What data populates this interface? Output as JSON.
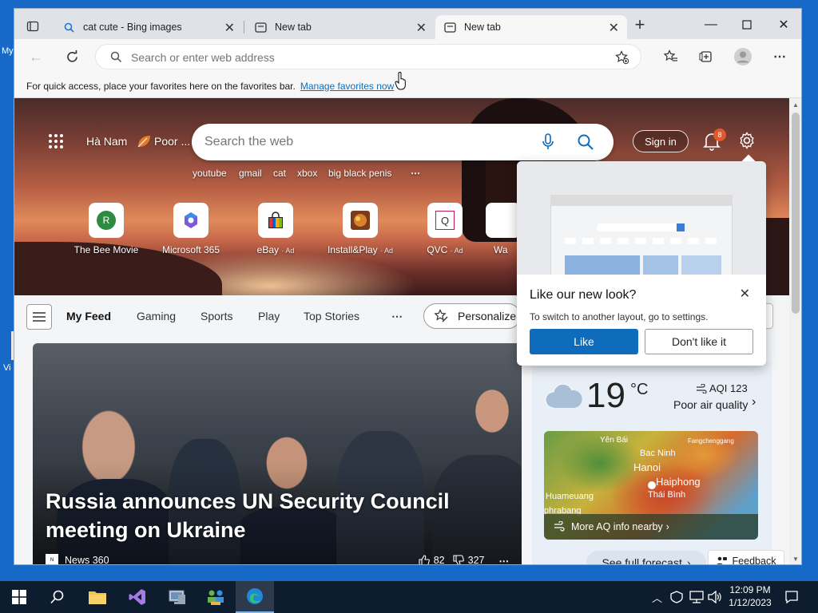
{
  "desktop": {
    "label_1": "My",
    "label_2": "Vi"
  },
  "tabs": [
    {
      "title": "cat cute - Bing images",
      "icon": "search-icon",
      "active": false
    },
    {
      "title": "New tab",
      "icon": "newtab-icon",
      "active": false
    },
    {
      "title": "New tab",
      "icon": "newtab-icon",
      "active": true
    }
  ],
  "address_bar": {
    "placeholder": "Search or enter web address",
    "value": ""
  },
  "favorites_bar": {
    "message": "For quick access, place your favorites here on the favorites bar.",
    "link": "Manage favorites now"
  },
  "hero": {
    "location": "Hà Nam",
    "air": "Poor ...",
    "search_placeholder": "Search the web",
    "sign_in": "Sign in",
    "notification_count": "8",
    "trending": [
      "youtube",
      "gmail",
      "cat",
      "xbox",
      "big black penis"
    ],
    "more": "⋯"
  },
  "tiles": [
    {
      "label": "The Bee Movie",
      "ad": "",
      "icon_text": "R"
    },
    {
      "label": "Microsoft 365",
      "ad": "",
      "icon_text": ""
    },
    {
      "label": "eBay",
      "ad": "· Ad",
      "icon_text": ""
    },
    {
      "label": "Install&Play",
      "ad": "· Ad",
      "icon_text": ""
    },
    {
      "label": "QVC",
      "ad": "· Ad",
      "icon_text": "Q"
    },
    {
      "label": "Wa",
      "ad": "",
      "icon_text": ""
    }
  ],
  "feed_nav": {
    "items": [
      "My Feed",
      "Gaming",
      "Sports",
      "Play",
      "Top Stories"
    ],
    "more": "⋯",
    "personalize": "Personalize"
  },
  "news": {
    "headline": "Russia announces UN Security Council meeting on Ukraine",
    "source": "News 360",
    "likes": "82",
    "dislikes": "327",
    "more": "⋯"
  },
  "weather": {
    "temp": "19",
    "unit": "°C",
    "aqi": "AQI 123",
    "aqi_status": "Poor air quality",
    "map_labels": [
      "Yên Bái",
      "Bac Ninh",
      "Fangchenggang",
      "Hanoi",
      "Haiphong",
      "Huameuang",
      "Thái Bình",
      "phrabang"
    ],
    "map_link": "More AQ info nearby",
    "forecast_link": "See full forecast",
    "feedback": "Feedback"
  },
  "popup": {
    "title": "Like our new look?",
    "body": "To switch to another layout, go to settings.",
    "like": "Like",
    "dislike": "Don't like it"
  },
  "clock": {
    "time": "12:09 PM",
    "date": "1/12/2023"
  },
  "colors": {
    "accent": "#0f6cbd",
    "taskbar": "#0d1c2e",
    "desktop": "#1669c7"
  }
}
